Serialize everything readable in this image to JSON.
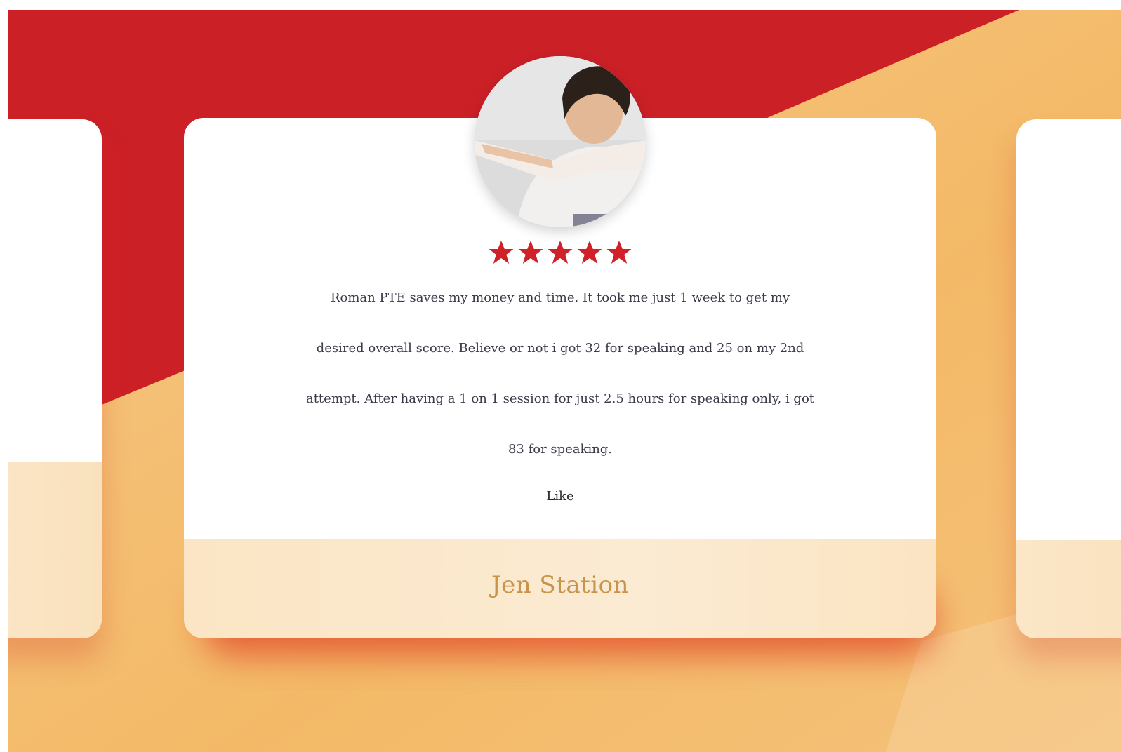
{
  "testimonial": {
    "rating": 5,
    "rating_max": 5,
    "review_lines": [
      "Roman PTE saves my money and time. It took me just 1 week to get my",
      "desired overall score. Believe or not i got 32 for speaking and  25 on my 2nd",
      "attempt. After having a 1 on 1 session for just 2.5 hours for speaking only,  i got",
      "83 for speaking."
    ],
    "like_label": "Like",
    "reviewer_name": "Jen Station"
  },
  "colors": {
    "brand_red": "#cc2027",
    "accent_orange": "#f3b967",
    "name_gold": "#c8934a",
    "star_red": "#d02128"
  },
  "icons": {
    "star": "star-icon"
  }
}
